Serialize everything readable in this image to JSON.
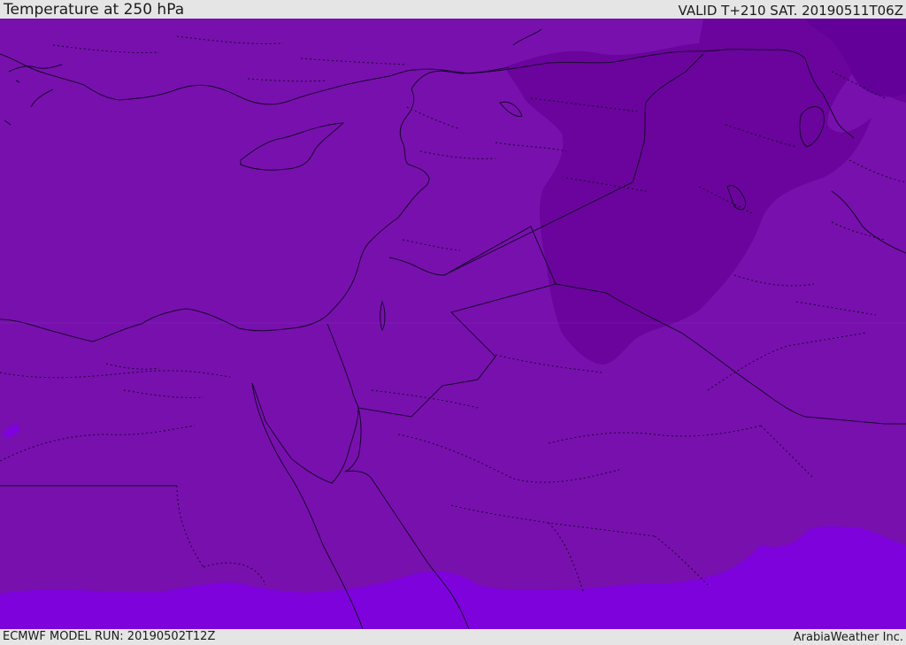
{
  "header": {
    "title": "Temperature at 250 hPa",
    "valid_time": "VALID T+210 SAT. 20190511T06Z"
  },
  "footer": {
    "model_run": "ECMWF MODEL RUN: 20190502T12Z",
    "credit": "ArabiaWeather Inc."
  },
  "map": {
    "colors": {
      "field_mid": "#7810ae",
      "field_cold": "#6a049c",
      "field_warm": "#7d02dc",
      "coastline": "#1a0530",
      "borders": "#1a0530"
    }
  }
}
